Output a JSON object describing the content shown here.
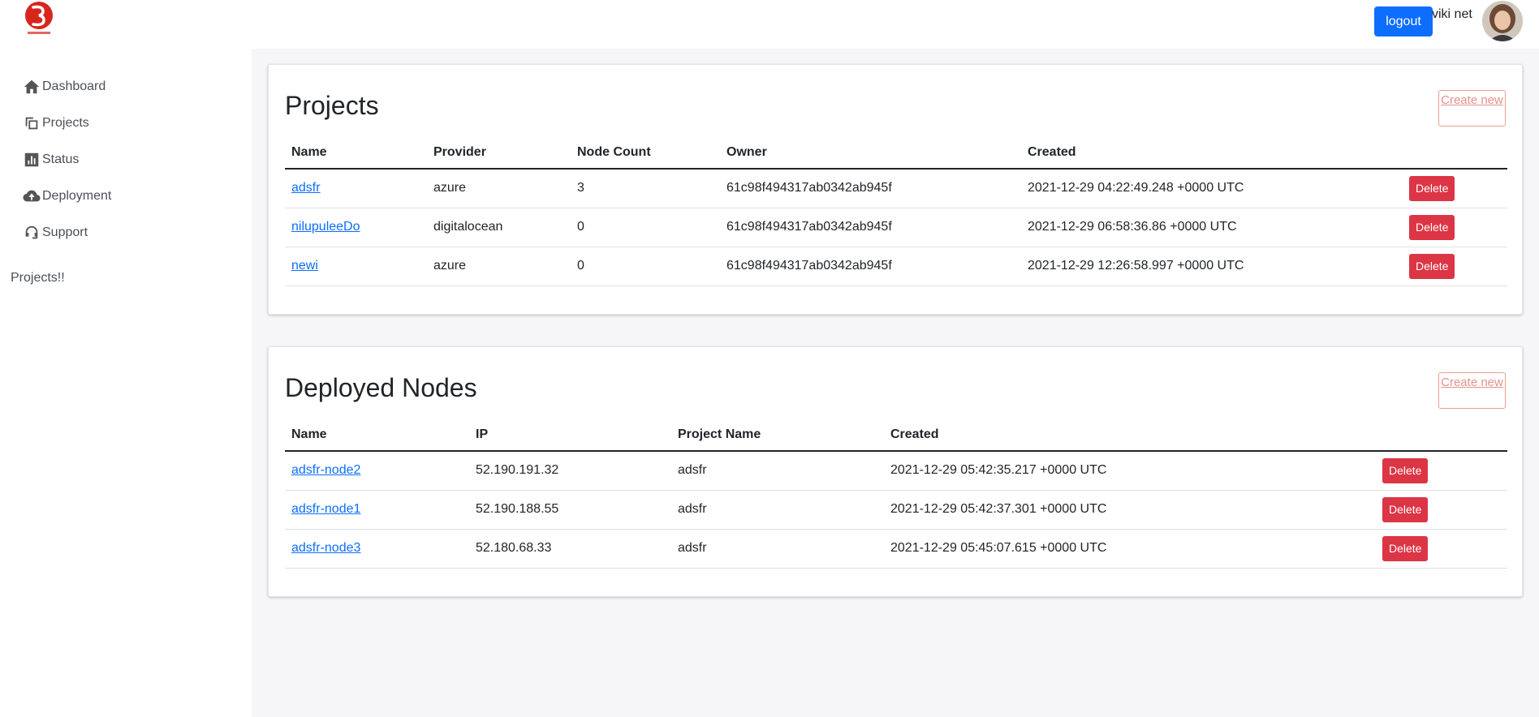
{
  "brand": {
    "logo_name": "app-logo"
  },
  "header": {
    "logout_label": "logout",
    "username": "viki net"
  },
  "sidebar": {
    "items": [
      {
        "label": "Dashboard",
        "icon": "home-icon"
      },
      {
        "label": "Projects",
        "icon": "copy-icon"
      },
      {
        "label": "Status",
        "icon": "chart-icon"
      },
      {
        "label": "Deployment",
        "icon": "cloud-upload-icon"
      },
      {
        "label": "Support",
        "icon": "headset-icon"
      }
    ],
    "note": "Projects!!"
  },
  "projects": {
    "title": "Projects",
    "create_label": "Create new",
    "columns": [
      "Name",
      "Provider",
      "Node Count",
      "Owner",
      "Created"
    ],
    "rows": [
      {
        "name": "adsfr",
        "provider": "azure",
        "node_count": "3",
        "owner": "61c98f494317ab0342ab945f",
        "created": "2021-12-29 04:22:49.248 +0000 UTC"
      },
      {
        "name": "nilupuleeDo",
        "provider": "digitalocean",
        "node_count": "0",
        "owner": "61c98f494317ab0342ab945f",
        "created": "2021-12-29 06:58:36.86 +0000 UTC"
      },
      {
        "name": "newi",
        "provider": "azure",
        "node_count": "0",
        "owner": "61c98f494317ab0342ab945f",
        "created": "2021-12-29 12:26:58.997 +0000 UTC"
      }
    ],
    "delete_label": "Delete"
  },
  "nodes": {
    "title": "Deployed Nodes",
    "create_label": "Create new",
    "columns": [
      "Name",
      "IP",
      "Project Name",
      "Created"
    ],
    "rows": [
      {
        "name": "adsfr-node2",
        "ip": "52.190.191.32",
        "project": "adsfr",
        "created": "2021-12-29 05:42:35.217 +0000 UTC"
      },
      {
        "name": "adsfr-node1",
        "ip": "52.190.188.55",
        "project": "adsfr",
        "created": "2021-12-29 05:42:37.301 +0000 UTC"
      },
      {
        "name": "adsfr-node3",
        "ip": "52.180.68.33",
        "project": "adsfr",
        "created": "2021-12-29 05:45:07.615 +0000 UTC"
      }
    ],
    "delete_label": "Delete"
  },
  "colors": {
    "primary": "#0d6efd",
    "danger": "#dc3545",
    "create_outline": "#e5918a",
    "logo_red": "#d7261e"
  }
}
